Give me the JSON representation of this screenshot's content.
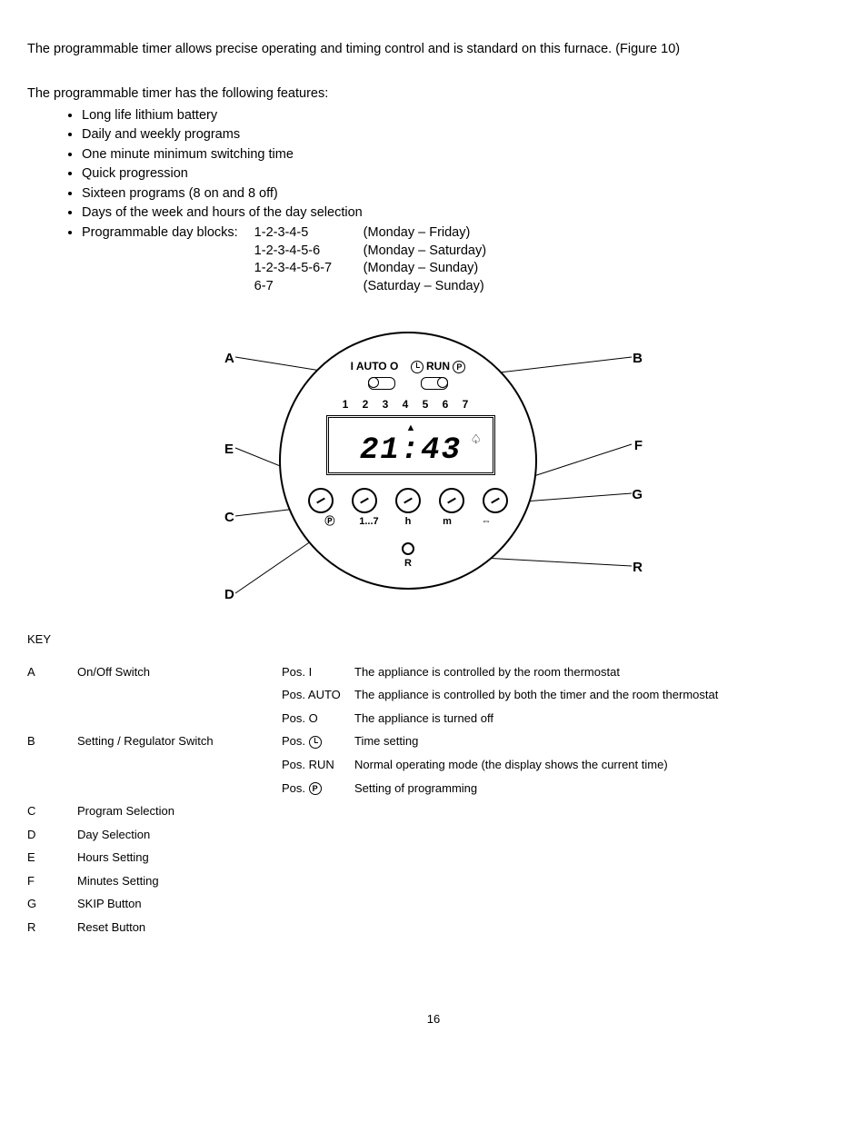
{
  "intro": "The programmable timer allows precise operating and timing control and is standard on this furnace.  (Figure 10)",
  "features_lead": "The programmable timer has the following features:",
  "features": [
    "Long life lithium battery",
    "Daily and weekly programs",
    "One minute minimum switching time",
    "Quick progression",
    "Sixteen programs (8 on and 8 off)",
    "Days of the week and hours of the day selection"
  ],
  "dayblocks_label": "Programmable day blocks:",
  "dayblocks": [
    {
      "code": "1-2-3-4-5",
      "range": "(Monday – Friday)"
    },
    {
      "code": "1-2-3-4-5-6",
      "range": "(Monday – Saturday)"
    },
    {
      "code": "1-2-3-4-5-6-7",
      "range": "(Monday – Sunday)"
    },
    {
      "code": "6-7",
      "range": "(Saturday – Sunday)"
    }
  ],
  "dial": {
    "top_left": "I  AUTO  O",
    "top_right_clock": "⏲",
    "top_right": "RUN",
    "top_right_p": "Ⓟ",
    "days": "1  2  3  4  5  6  7",
    "lcd_time": "21:43",
    "lcd_arrow": "▲",
    "lcd_bell": "♤",
    "btn_labels": {
      "b1": "Ⓟ",
      "b2": "1...7",
      "b3": "h",
      "b4": "m",
      "b5": "⇔"
    },
    "reset": "R",
    "reset_o": "O"
  },
  "labels": {
    "A": "A",
    "B": "B",
    "C": "C",
    "D": "D",
    "E": "E",
    "F": "F",
    "G": "G",
    "R": "R"
  },
  "key_heading": "KEY",
  "key": [
    {
      "letter": "A",
      "label": "On/Off Switch",
      "positions": [
        {
          "pos": "Pos. I",
          "desc": "The appliance is controlled by the room thermostat"
        },
        {
          "pos": "Pos. AUTO",
          "desc": "The appliance is controlled by both the timer and the room thermostat"
        },
        {
          "pos": "Pos. O",
          "desc": "The appliance is turned off"
        }
      ]
    },
    {
      "letter": "B",
      "label": "Setting / Regulator Switch",
      "positions": [
        {
          "pos_prefix": "Pos. ",
          "icon": "clock",
          "desc": "Time setting"
        },
        {
          "pos": "Pos. RUN",
          "desc": "Normal operating mode (the display shows the current time)"
        },
        {
          "pos_prefix": "Pos. ",
          "icon": "p",
          "desc": "Setting of programming"
        }
      ]
    },
    {
      "letter": "C",
      "label": "Program Selection"
    },
    {
      "letter": "D",
      "label": "Day Selection"
    },
    {
      "letter": "E",
      "label": "Hours Setting"
    },
    {
      "letter": "F",
      "label": "Minutes Setting"
    },
    {
      "letter": "G",
      "label": "SKIP Button"
    },
    {
      "letter": "R",
      "label": "Reset Button"
    }
  ],
  "page_number": "16"
}
